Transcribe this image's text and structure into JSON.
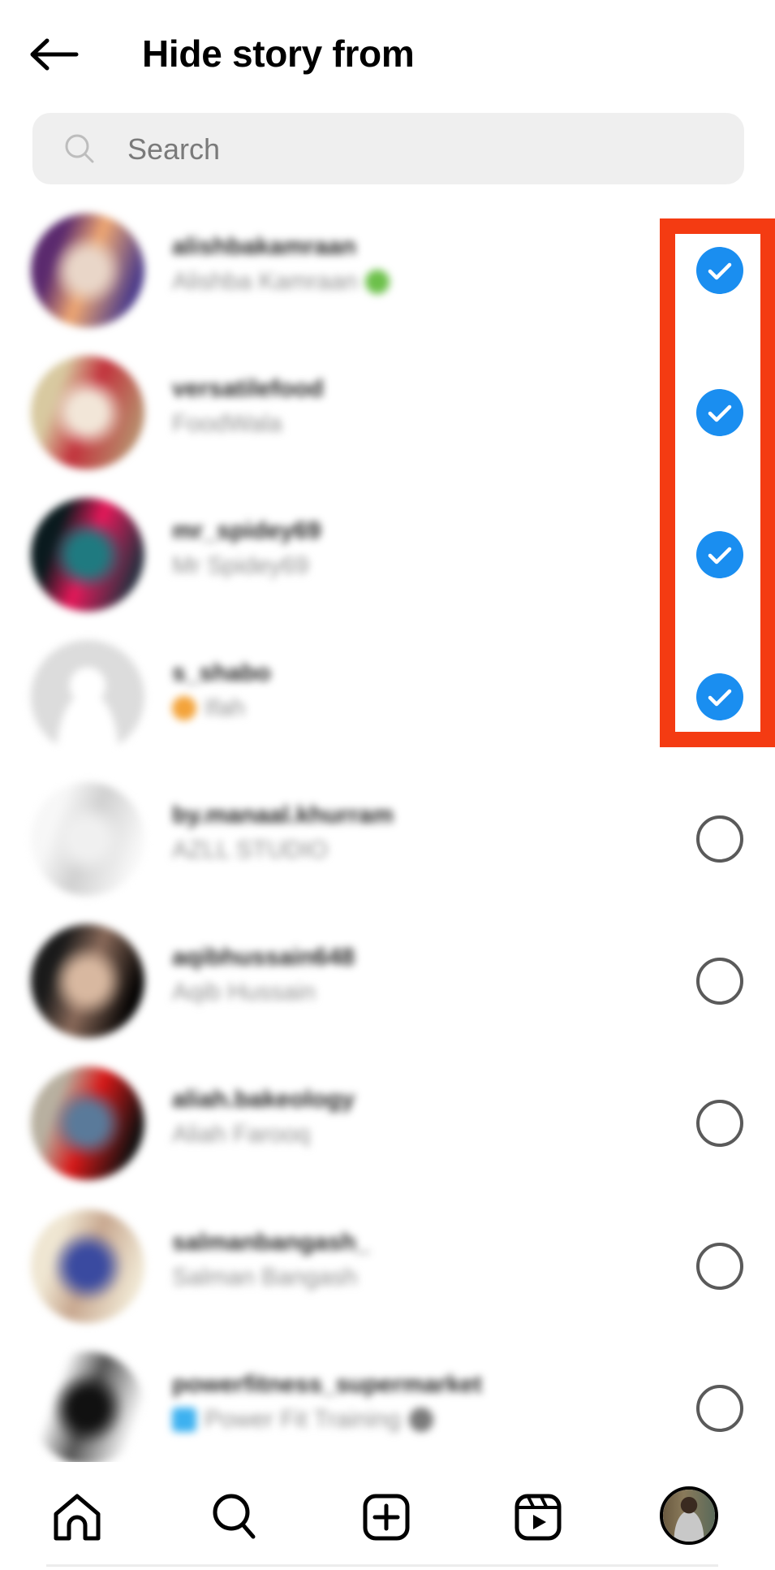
{
  "header": {
    "title": "Hide story from",
    "back_icon": "arrow-left-icon"
  },
  "search": {
    "placeholder": "Search",
    "value": "",
    "icon": "search-icon"
  },
  "colors": {
    "accent_blue": "#1a8ef0",
    "highlight_red": "#f43b12",
    "search_bg": "#efefef",
    "unchecked_border": "#5a5a5a",
    "subtitle_gray": "#8e8e8e"
  },
  "accounts": [
    {
      "username": "alishbakamraan",
      "name": "Alishba Kamraan",
      "selected": true,
      "badge": "green-leaf",
      "avatar": [
        "#5b2a6e",
        "#e9d6c8",
        "#f0a872",
        "#4a3a8a"
      ]
    },
    {
      "username": "versatilefood",
      "name": "FoodWala",
      "selected": true,
      "badge": null,
      "avatar": [
        "#d8c9a0",
        "#f2e6d8",
        "#c2323c",
        "#b88a6a"
      ]
    },
    {
      "username": "mr_spidey69",
      "name": "Mr Spidey69",
      "selected": true,
      "badge": null,
      "avatar": [
        "#0a1a1e",
        "#1f7a80",
        "#e8185a",
        "#2a3040"
      ]
    },
    {
      "username": "s_shabo",
      "name": "Ifah",
      "selected": true,
      "badge": "orange-star",
      "avatar": [
        "#dcdcdc",
        "#ffffff",
        "#dcdcdc",
        "#dcdcdc"
      ],
      "default_avatar": true
    },
    {
      "username": "by.manaal.khurram",
      "name": "AZLL STUDIO",
      "selected": false,
      "badge": null,
      "avatar": [
        "#f7f7f7",
        "#f0f0f0",
        "#d0d0d0",
        "#f7f7f7"
      ]
    },
    {
      "username": "aqibhussain648",
      "name": "Aqib Hussain",
      "selected": false,
      "badge": null,
      "avatar": [
        "#1a1a1a",
        "#d8b8a0",
        "#8a6a5a",
        "#000000"
      ]
    },
    {
      "username": "aliah.bakeology",
      "name": "Aliah Farooq",
      "selected": false,
      "badge": null,
      "avatar": [
        "#b8b0a0",
        "#5a7a9a",
        "#d81818",
        "#101010"
      ]
    },
    {
      "username": "salmanbangash_",
      "name": "Salman Bangash",
      "selected": false,
      "badge": null,
      "avatar": [
        "#efe6d2",
        "#3a4aa0",
        "#c8a890",
        "#efe6d2"
      ]
    },
    {
      "username": "powerfitness_supermarket",
      "name": "Power Fit Training",
      "selected": false,
      "badge": "blue-square",
      "trailing_badge": "gray-dot",
      "avatar": [
        "#ffffff",
        "#111111",
        "#555555",
        "#ffffff"
      ]
    }
  ],
  "bottom_nav": [
    {
      "id": "home",
      "icon": "home-icon"
    },
    {
      "id": "search",
      "icon": "search-icon"
    },
    {
      "id": "create",
      "icon": "plus-square-icon"
    },
    {
      "id": "reels",
      "icon": "reels-icon"
    },
    {
      "id": "profile",
      "icon": "profile-avatar"
    }
  ]
}
